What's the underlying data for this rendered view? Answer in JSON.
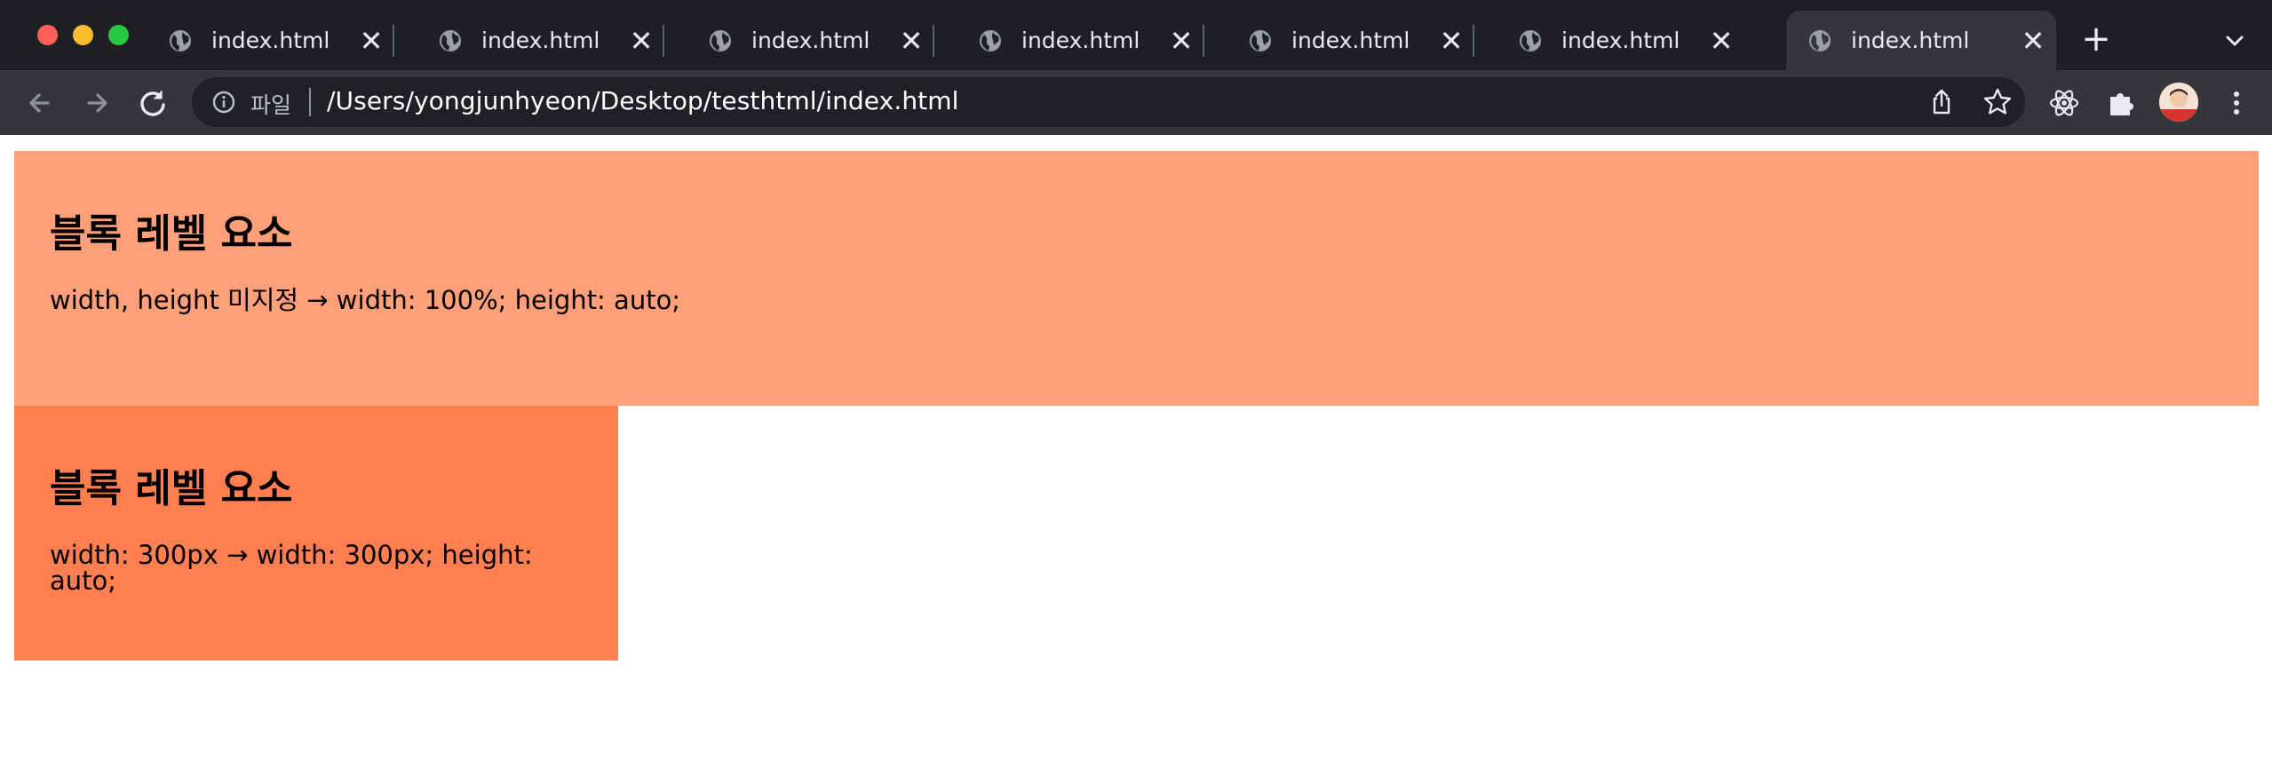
{
  "window": {
    "traffic_lights": [
      "close",
      "minimize",
      "zoom"
    ]
  },
  "tabs": [
    {
      "title": "index.html",
      "icon": "globe-icon",
      "active": false
    },
    {
      "title": "index.html",
      "icon": "globe-icon",
      "active": false
    },
    {
      "title": "index.html",
      "icon": "globe-icon",
      "active": false
    },
    {
      "title": "index.html",
      "icon": "globe-icon",
      "active": false
    },
    {
      "title": "index.html",
      "icon": "globe-icon",
      "active": false
    },
    {
      "title": "index.html",
      "icon": "globe-icon",
      "active": false
    },
    {
      "title": "index.html",
      "icon": "globe-icon",
      "active": true
    }
  ],
  "tab_close_glyph": "✕",
  "new_tab_glyph": "+",
  "toolbar": {
    "back_icon": "arrow-left-icon",
    "forward_icon": "arrow-right-icon",
    "reload_icon": "reload-icon",
    "address": {
      "info_icon": "info-icon",
      "scheme_label": "파일",
      "url": "/Users/yongjunhyeon/Desktop/testhtml/index.html"
    },
    "share_icon": "share-icon",
    "bookmark_icon": "star-icon",
    "extensions": [
      "react-devtools-icon",
      "puzzle-extension-icon"
    ],
    "menu_icon": "kebab-menu-icon"
  },
  "content": {
    "blocks": [
      {
        "heading": "블록 레벨 요소",
        "text": "width, height 미지정 → width: 100%; height: auto;",
        "color": "#ffa07a"
      },
      {
        "heading": "블록 레벨 요소",
        "text": "width: 300px → width: 300px; height: auto;",
        "color": "#ff7f50"
      }
    ]
  },
  "colors": {
    "tabstrip_bg": "#1f2023",
    "toolbar_bg": "#35363a",
    "omnibox_bg": "#202124"
  }
}
